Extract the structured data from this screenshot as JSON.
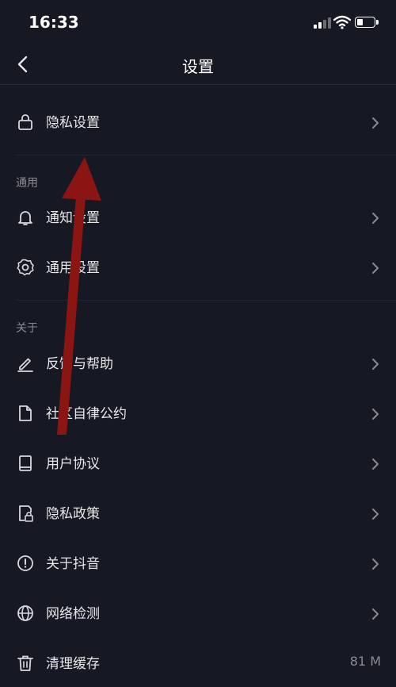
{
  "status": {
    "time": "16:33"
  },
  "nav": {
    "title": "设置"
  },
  "privacy_row": {
    "label": "隐私设置"
  },
  "sections": {
    "general": "通用",
    "about": "关于"
  },
  "general_items": [
    {
      "label": "通知设置",
      "icon": "bell-icon"
    },
    {
      "label": "通用设置",
      "icon": "gear-icon"
    }
  ],
  "about_items": [
    {
      "label": "反馈与帮助",
      "icon": "edit-icon"
    },
    {
      "label": "社区自律公约",
      "icon": "document-icon"
    },
    {
      "label": "用户协议",
      "icon": "book-icon"
    },
    {
      "label": "隐私政策",
      "icon": "lock-document-icon"
    },
    {
      "label": "关于抖音",
      "icon": "info-icon"
    },
    {
      "label": "网络检测",
      "icon": "globe-icon"
    },
    {
      "label": "清理缓存",
      "icon": "trash-icon",
      "value": "81 M"
    }
  ],
  "colors": {
    "background": "#161823",
    "text": "#e8e8ea",
    "muted": "#8a8b91",
    "annotation_arrow": "#8a1512"
  }
}
